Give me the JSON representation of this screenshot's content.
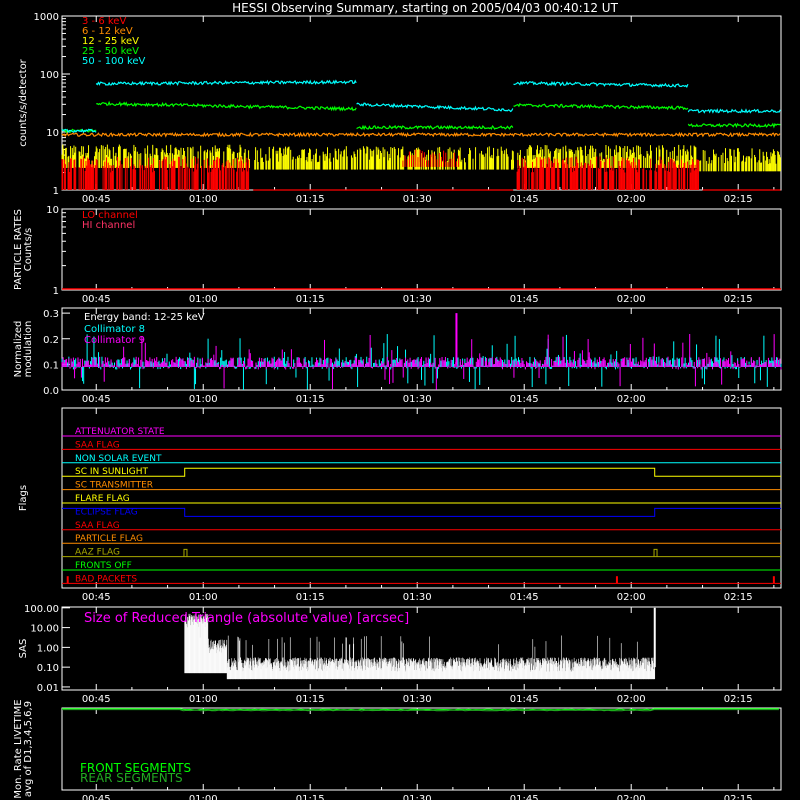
{
  "title": "HESSI Observing Summary, starting on 2005/04/03 00:40:12 UT",
  "time_ticks": [
    "00:45",
    "01:00",
    "01:15",
    "01:30",
    "01:45",
    "02:00",
    "02:15"
  ],
  "time_range_min": [
    40.2,
    141.0
  ],
  "colors": {
    "background": "#000000",
    "axis": "#ffffff",
    "band_3_6": "#ff0000",
    "band_6_12": "#ff8c00",
    "band_12_25": "#ffff00",
    "band_25_50": "#00ff00",
    "band_50_100": "#00ffff",
    "magenta": "#ff00ff",
    "cyan": "#00ffff",
    "green": "#00ff00",
    "blue": "#0000ff",
    "red": "#ff0000",
    "orange": "#ff8c00",
    "yellow": "#ffff00",
    "olive": "#aaaa00"
  },
  "chart_data": [
    {
      "panel": "count-rates",
      "type": "line",
      "ylabel": "counts/s/detector",
      "yscale": "log",
      "ylim": [
        1,
        1000
      ],
      "ytick_labels": [
        "1",
        "10",
        "100",
        "1000"
      ],
      "legend_position": "top-left",
      "series": [
        {
          "name": "3 - 6 keV",
          "segments": [
            {
              "x": [
                40.2,
                66.5
              ],
              "y": [
                2.0,
                2.0
              ],
              "noisy": true
            },
            {
              "x": [
                67.0,
                103.5
              ],
              "y": [
                1.0,
                1.0
              ]
            },
            {
              "x": [
                104.0,
                129.5
              ],
              "y": [
                2.0,
                2.0
              ],
              "noisy": true
            },
            {
              "x": [
                130.0,
                141.0
              ],
              "y": [
                1.0,
                1.0
              ]
            }
          ]
        },
        {
          "name": "6 - 12 keV",
          "segments": [
            {
              "x": [
                40.2,
                141.0
              ],
              "y": [
                9.0,
                9.0
              ],
              "noisy": true
            }
          ]
        },
        {
          "name": "12 - 25 keV",
          "segments": [
            {
              "x": [
                40.2,
                66.5
              ],
              "y": [
                3.2,
                3.2
              ],
              "noisy": true
            },
            {
              "x": [
                66.5,
                103.5
              ],
              "y": [
                3.0,
                3.0
              ],
              "noisy": true
            },
            {
              "x": [
                103.5,
                129.5
              ],
              "y": [
                3.2,
                3.2
              ],
              "noisy": true
            },
            {
              "x": [
                129.5,
                141.0
              ],
              "y": [
                2.8,
                2.8
              ],
              "noisy": true
            }
          ]
        },
        {
          "name": "25 - 50 keV",
          "segments": [
            {
              "x": [
                40.2,
                45.0
              ],
              "y": [
                10.5,
                10.5
              ]
            },
            {
              "x": [
                45.0,
                81.5
              ],
              "y": [
                31,
                25
              ]
            },
            {
              "x": [
                81.5,
                103.5
              ],
              "y": [
                12,
                12
              ]
            },
            {
              "x": [
                103.5,
                128.0
              ],
              "y": [
                29,
                26
              ]
            },
            {
              "x": [
                128.0,
                141.0
              ],
              "y": [
                13,
                13
              ]
            }
          ]
        },
        {
          "name": "50 - 100 keV",
          "segments": [
            {
              "x": [
                40.2,
                45.0
              ],
              "y": [
                10.5,
                10.5
              ]
            },
            {
              "x": [
                45.0,
                81.5
              ],
              "y": [
                68,
                73
              ]
            },
            {
              "x": [
                81.5,
                103.5
              ],
              "y": [
                30,
                24
              ]
            },
            {
              "x": [
                103.5,
                128.0
              ],
              "y": [
                70,
                63
              ]
            },
            {
              "x": [
                128.0,
                141.0
              ],
              "y": [
                23,
                23
              ]
            }
          ]
        }
      ]
    },
    {
      "panel": "particle-rates",
      "type": "line",
      "ylabel_lines": [
        "PARTICLE RATES",
        "Counts/s"
      ],
      "yscale": "log",
      "ylim": [
        1,
        10
      ],
      "ytick_labels": [
        "1",
        "10"
      ],
      "legend_position": "top-left",
      "series": [
        {
          "name": "LO channel",
          "x": [
            40.2,
            141.0
          ],
          "y": [
            1.0,
            1.0
          ]
        },
        {
          "name": "HI channel",
          "x": [
            40.2,
            141.0
          ],
          "y": [
            1.0,
            1.0
          ]
        }
      ]
    },
    {
      "panel": "modulation",
      "type": "line",
      "ylabel_lines": [
        "Normalized",
        "modulation"
      ],
      "ylim": [
        0.0,
        0.32
      ],
      "ytick_labels": [
        "0.0",
        "0.1",
        "0.2",
        "0.3"
      ],
      "annotation": "Energy band: 12-25 keV",
      "legend_position": "top-left",
      "series": [
        {
          "name": "Collimator 8",
          "baseline": 0.1,
          "noisy": true
        },
        {
          "name": "Collimator 9",
          "baseline": 0.1,
          "noisy": true
        }
      ]
    },
    {
      "panel": "flags",
      "type": "line",
      "ylabel": "Flags",
      "series": [
        {
          "name": "ATTENUATOR STATE",
          "level": 0,
          "transitions": []
        },
        {
          "name": "SAA FLAG",
          "level": 0,
          "transitions": []
        },
        {
          "name": "NON SOLAR EVENT",
          "level": 0,
          "transitions": []
        },
        {
          "name": "SC IN SUNLIGHT",
          "level": 0,
          "transitions": [
            [
              57.4,
              1
            ],
            [
              123.3,
              0
            ]
          ]
        },
        {
          "name": "SC TRANSMITTER",
          "level": 0,
          "transitions": []
        },
        {
          "name": "FLARE FLAG",
          "level": 0,
          "transitions": []
        },
        {
          "name": "ECLIPSE FLAG",
          "level": 1,
          "transitions": [
            [
              57.4,
              0
            ],
            [
              123.3,
              1
            ]
          ]
        },
        {
          "name": "SAA FLAG",
          "level": 0,
          "transitions": []
        },
        {
          "name": "PARTICLE FLAG",
          "level": 0,
          "transitions": []
        },
        {
          "name": "AAZ FLAG",
          "level": 0,
          "pulses": [
            57.3,
            123.2
          ]
        },
        {
          "name": "FRONTS OFF",
          "level": 0,
          "transitions": []
        },
        {
          "name": "BAD PACKETS",
          "level": 0,
          "spikes": [
            41.0,
            118.0,
            140.0
          ]
        }
      ]
    },
    {
      "panel": "sas",
      "type": "line",
      "ylabel": "SAS",
      "yscale": "log",
      "ylim": [
        0.007,
        110
      ],
      "ytick_labels": [
        "0.01",
        "0.10",
        "1.00",
        "10.00",
        "100.00"
      ],
      "annotation": "Size of Reduced Triangle (absolute value) [arcsec]",
      "series": [
        {
          "name": "Size of Reduced Triangle",
          "x": [
            57.4,
            123.3
          ],
          "baseline": 0.05,
          "spike_start": 100,
          "spike_end": 100,
          "noisy": true
        }
      ]
    },
    {
      "panel": "livetime",
      "type": "line",
      "ylabel_lines": [
        "Mon. Rate LIVETIME",
        "avg of D1,3,4,5,6,9"
      ],
      "ylim": [
        0,
        1
      ],
      "legend_position": "bottom-left",
      "series": [
        {
          "name": "FRONT SEGMENTS",
          "x": [
            40.2,
            141.0
          ],
          "y": [
            0.99,
            0.99
          ]
        },
        {
          "name": "REAR SEGMENTS",
          "x": [
            40.2,
            141.0
          ],
          "y": [
            0.98,
            0.98
          ]
        }
      ]
    }
  ]
}
